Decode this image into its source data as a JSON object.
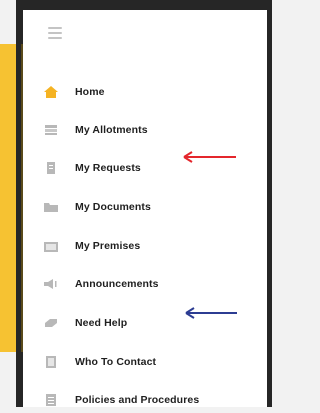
{
  "sidebar": {
    "items": [
      {
        "label": "Home",
        "icon": "home-icon",
        "active": true
      },
      {
        "label": "My Allotments",
        "icon": "allotments-icon"
      },
      {
        "label": "My Requests",
        "icon": "requests-icon"
      },
      {
        "label": "My Documents",
        "icon": "folder-icon"
      },
      {
        "label": "My Premises",
        "icon": "premises-icon"
      },
      {
        "label": "Announcements",
        "icon": "megaphone-icon"
      },
      {
        "label": "Need Help",
        "icon": "help-icon"
      },
      {
        "label": "Who To Contact",
        "icon": "contact-icon"
      },
      {
        "label": "Policies and Procedures",
        "icon": "policies-icon"
      }
    ]
  },
  "annotations": {
    "red_arrow_color": "#e4262c",
    "blue_arrow_color": "#2c3c92"
  },
  "colors": {
    "accent_yellow": "#f6c232",
    "icon_gray": "#b8b8b8",
    "home_icon": "#f5b323"
  }
}
